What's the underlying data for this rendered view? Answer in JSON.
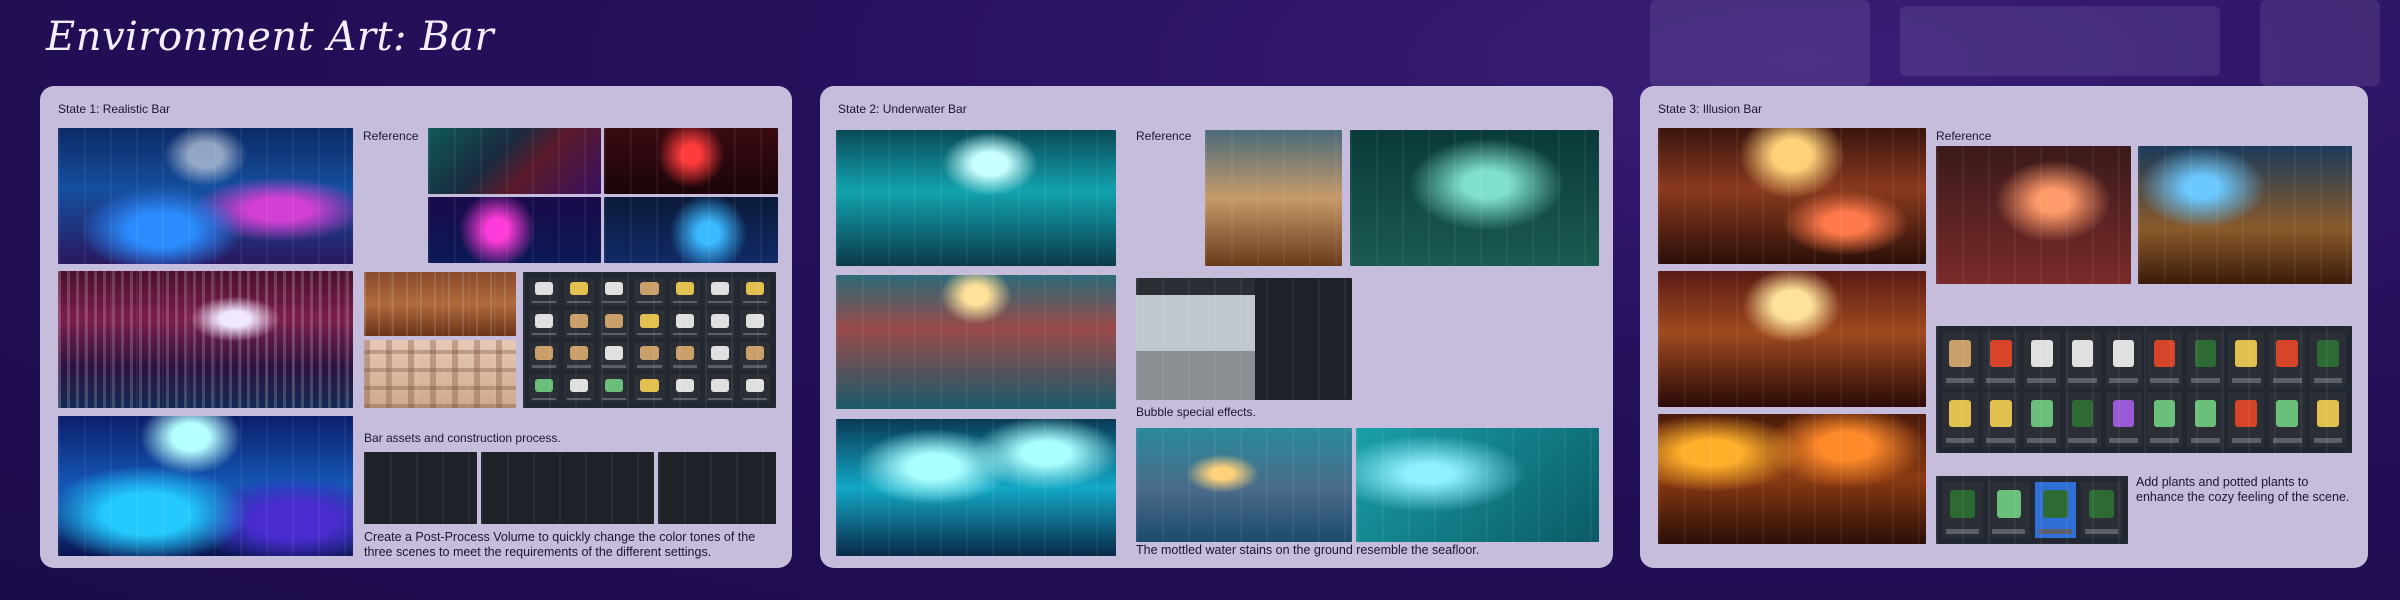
{
  "page": {
    "title": "Environment Art: Bar"
  },
  "panels": {
    "state1": {
      "title": "State 1: Realistic Bar",
      "reference_label": "Reference",
      "caption_assets": "Bar assets and construction process.",
      "caption_postprocess_line1": "Create a Post-Process Volume to quickly change the color tones of the",
      "caption_postprocess_line2": "three scenes to meet the requirements of the different settings."
    },
    "state2": {
      "title": "State 2: Underwater Bar",
      "reference_label": "Reference",
      "caption_bubble": "Bubble special effects.",
      "caption_floor": "The mottled water stains on the ground resemble the seafloor."
    },
    "state3": {
      "title": "State 3: Illusion Bar",
      "reference_label": "Reference",
      "caption_plants_line1": "Add plants and potted plants to",
      "caption_plants_line2": "enhance the cozy feeling of the scene."
    }
  },
  "colors": {
    "background": "#23104f",
    "panel": "#c6bddd",
    "text": "#1b1530",
    "title": "#f3eefc"
  }
}
